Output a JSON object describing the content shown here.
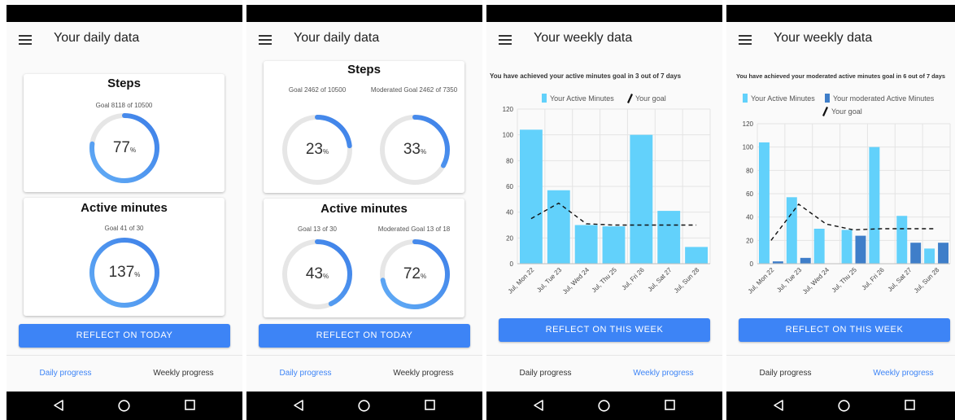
{
  "colors": {
    "accent": "#3d84f6",
    "bar_primary": "#62d1fb",
    "bar_secondary": "#3f7ec9",
    "goal_line": "#111111",
    "ring_track": "#e6e6e6"
  },
  "screens": [
    {
      "title": "Your daily data",
      "cards": [
        {
          "title": "Steps",
          "rings": [
            {
              "goal": "Goal 8118 of 10500",
              "percent": "77",
              "fraction": 0.77
            }
          ]
        },
        {
          "title": "Active minutes",
          "rings": [
            {
              "goal": "Goal 41 of 30",
              "percent": "137",
              "fraction": 1.0
            }
          ]
        }
      ],
      "button": "REFLECT ON TODAY",
      "nav": {
        "daily": "Daily progress",
        "weekly": "Weekly progress",
        "active": "daily"
      }
    },
    {
      "title": "Your daily data",
      "cards": [
        {
          "title": "Steps",
          "rings": [
            {
              "goal": "Goal 2462 of 10500",
              "percent": "23",
              "fraction": 0.23
            },
            {
              "goal": "Moderated Goal 2462 of 7350",
              "percent": "33",
              "fraction": 0.33
            }
          ]
        },
        {
          "title": "Active minutes",
          "rings": [
            {
              "goal": "Goal 13 of 30",
              "percent": "43",
              "fraction": 0.43
            },
            {
              "goal": "Moderated Goal 13 of 18",
              "percent": "72",
              "fraction": 0.72
            }
          ]
        }
      ],
      "button": "REFLECT ON TODAY",
      "nav": {
        "daily": "Daily progress",
        "weekly": "Weekly progress",
        "active": "daily"
      }
    },
    {
      "title": "Your weekly data",
      "heading": "You have achieved your active minutes goal in 3 out of 7 days",
      "button": "REFLECT ON THIS WEEK",
      "nav": {
        "daily": "Daily progress",
        "weekly": "Weekly progress",
        "active": "weekly"
      }
    },
    {
      "title": "Your weekly data",
      "heading": "You have achieved your moderated active minutes goal in 6 out of 7 days",
      "button": "REFLECT ON THIS WEEK",
      "nav": {
        "daily": "Daily progress",
        "weekly": "Weekly progress",
        "active": "weekly"
      }
    }
  ],
  "chart_data": [
    {
      "type": "bar",
      "categories": [
        "Jul, Mon 22",
        "Jul, Tue 23",
        "Jul, Wed 24",
        "Jul, Thu 25",
        "Jul, Fri 26",
        "Jul, Sat 27",
        "Jul, Sun 28"
      ],
      "series": [
        {
          "name": "Your Active Minutes",
          "values": [
            104,
            57,
            30,
            29,
            100,
            41,
            13
          ]
        }
      ],
      "goal": {
        "name": "Your goal",
        "values": [
          35,
          47,
          31,
          30,
          30,
          30,
          30
        ]
      },
      "yticks": [
        0,
        20,
        40,
        60,
        80,
        100,
        120
      ],
      "ylim": [
        0,
        120
      ],
      "grid": true,
      "legend": "top"
    },
    {
      "type": "bar",
      "categories": [
        "Jul, Mon 22",
        "Jul, Tue 23",
        "Jul, Wed 24",
        "Jul, Thu 25",
        "Jul, Fri 26",
        "Jul, Sat 27",
        "Jul, Sun 28"
      ],
      "series": [
        {
          "name": "Your Active Minutes",
          "values": [
            104,
            57,
            30,
            29,
            100,
            41,
            13
          ]
        },
        {
          "name": "Your moderated Active Minutes",
          "values": [
            2,
            5,
            0,
            24,
            0,
            18,
            18
          ]
        }
      ],
      "goal": {
        "name": "Your goal",
        "values": [
          20,
          51,
          34,
          29,
          30,
          30,
          30
        ]
      },
      "yticks": [
        0,
        20,
        40,
        60,
        80,
        100,
        120
      ],
      "ylim": [
        0,
        120
      ],
      "grid": true,
      "legend": "top"
    }
  ]
}
